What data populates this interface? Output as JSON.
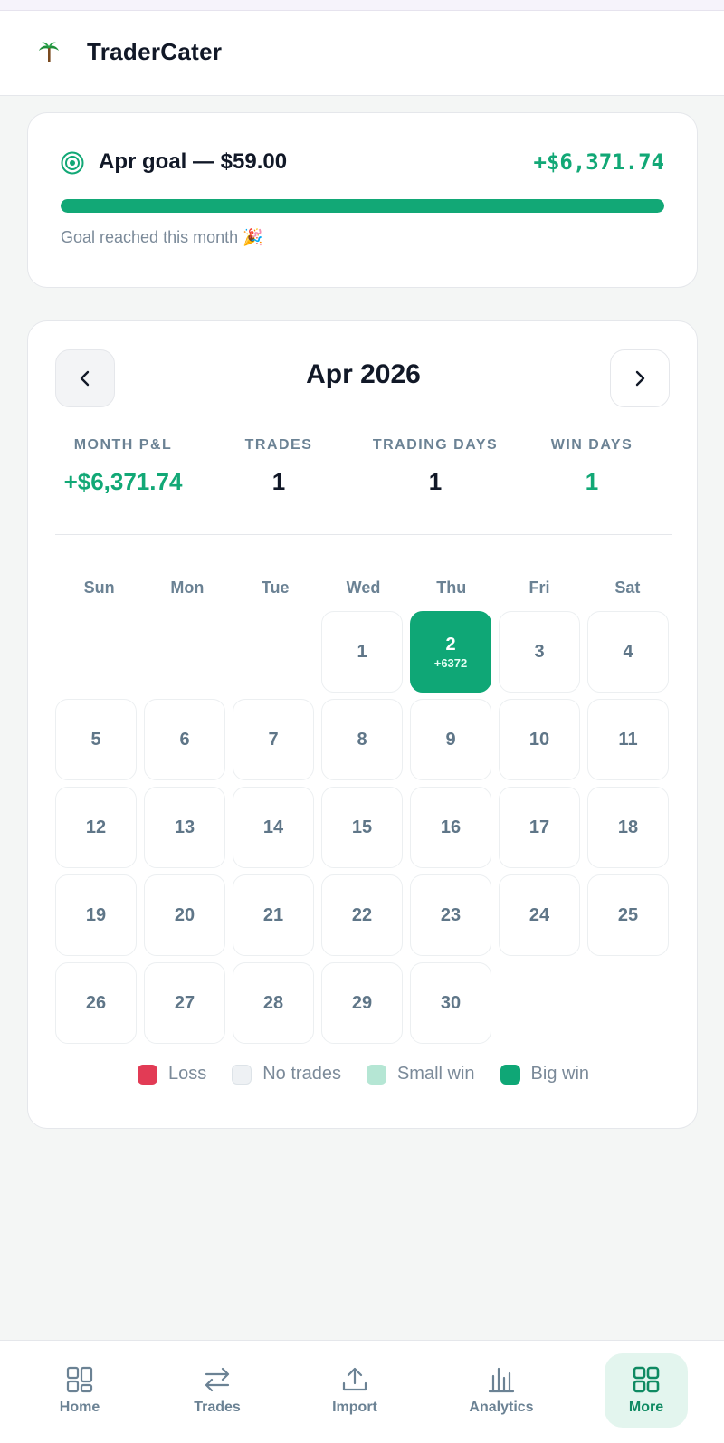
{
  "app": {
    "title": "TraderCater",
    "logo_icon": "palm-tree-icon"
  },
  "goal": {
    "title": "Apr goal — $59.00",
    "amount": "+$6,371.74",
    "progress_percent": 100,
    "note": "Goal reached this month 🎉",
    "icon": "target-icon"
  },
  "calendar": {
    "month_title": "Apr 2026",
    "stats": [
      {
        "label": "MONTH P&L",
        "value": "+$6,371.74",
        "green": true
      },
      {
        "label": "TRADES",
        "value": "1",
        "green": false
      },
      {
        "label": "TRADING DAYS",
        "value": "1",
        "green": false
      },
      {
        "label": "WIN DAYS",
        "value": "1",
        "green": true
      }
    ],
    "weekdays": [
      "Sun",
      "Mon",
      "Tue",
      "Wed",
      "Thu",
      "Fri",
      "Sat"
    ],
    "leading_blank_days": 3,
    "days": [
      {
        "day": "1"
      },
      {
        "day": "2",
        "pnl": "+6372",
        "status": "bigwin"
      },
      {
        "day": "3"
      },
      {
        "day": "4"
      },
      {
        "day": "5"
      },
      {
        "day": "6"
      },
      {
        "day": "7"
      },
      {
        "day": "8"
      },
      {
        "day": "9"
      },
      {
        "day": "10"
      },
      {
        "day": "11"
      },
      {
        "day": "12"
      },
      {
        "day": "13"
      },
      {
        "day": "14"
      },
      {
        "day": "15"
      },
      {
        "day": "16"
      },
      {
        "day": "17"
      },
      {
        "day": "18"
      },
      {
        "day": "19"
      },
      {
        "day": "20"
      },
      {
        "day": "21"
      },
      {
        "day": "22"
      },
      {
        "day": "23"
      },
      {
        "day": "24"
      },
      {
        "day": "25"
      },
      {
        "day": "26"
      },
      {
        "day": "27"
      },
      {
        "day": "28"
      },
      {
        "day": "29"
      },
      {
        "day": "30"
      }
    ],
    "legend": [
      {
        "label": "Loss",
        "color": "#e23b55"
      },
      {
        "label": "No trades",
        "color": "#eef1f4"
      },
      {
        "label": "Small win",
        "color": "#b5e6d4"
      },
      {
        "label": "Big win",
        "color": "#0fa776"
      }
    ]
  },
  "bottom_nav": [
    {
      "label": "Home",
      "icon": "home-grid-icon",
      "active": false
    },
    {
      "label": "Trades",
      "icon": "swap-arrows-icon",
      "active": false
    },
    {
      "label": "Import",
      "icon": "upload-icon",
      "active": false
    },
    {
      "label": "Analytics",
      "icon": "bar-chart-icon",
      "active": false
    },
    {
      "label": "More",
      "icon": "more-grid-icon",
      "active": true
    }
  ],
  "colors": {
    "accent": "#12a876",
    "text_muted": "#6b8294"
  }
}
